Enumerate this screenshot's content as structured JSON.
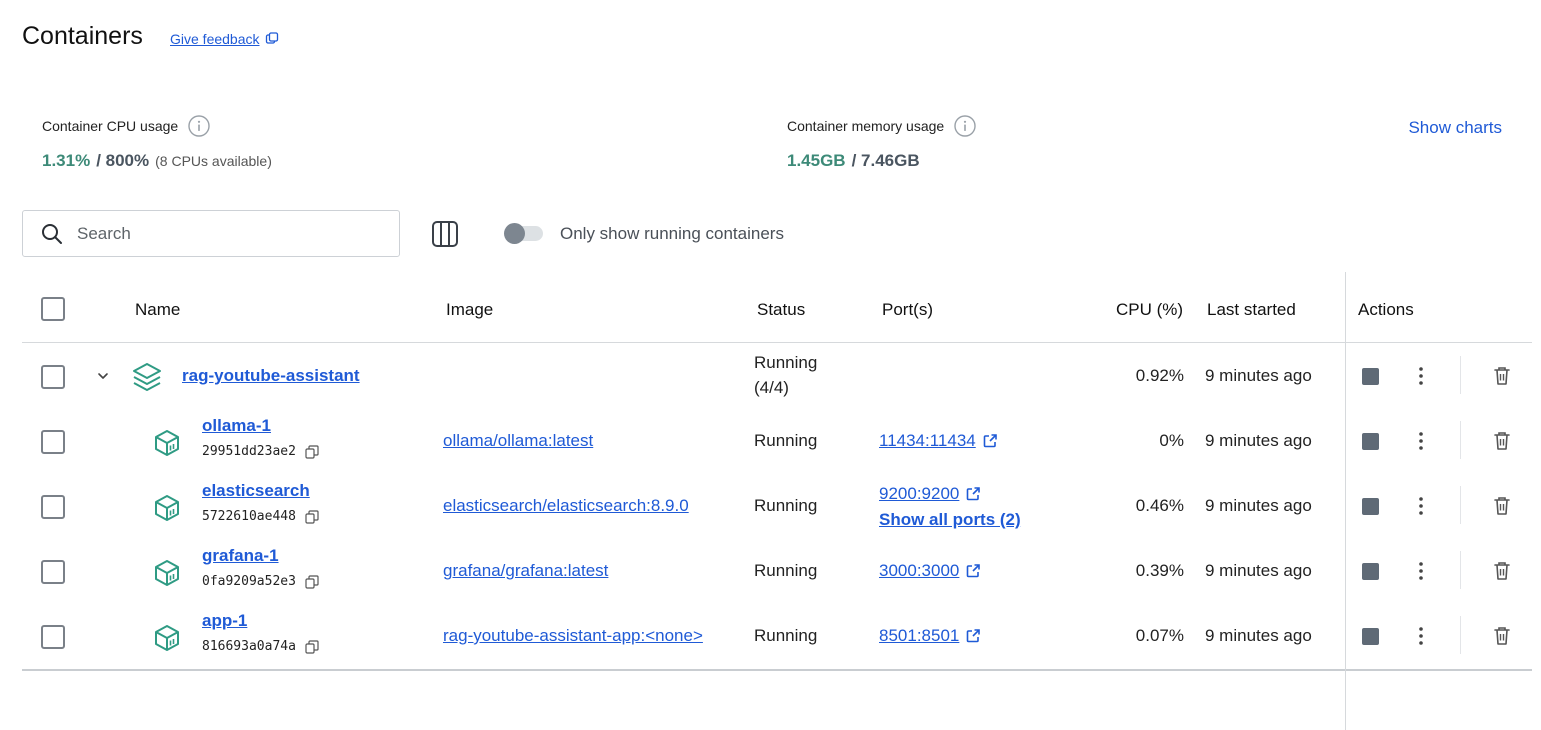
{
  "header": {
    "title": "Containers",
    "feedback_label": "Give feedback"
  },
  "stats": {
    "cpu": {
      "label": "Container CPU usage",
      "used": "1.31%",
      "total": "/ 800%",
      "note": "(8 CPUs available)"
    },
    "memory": {
      "label": "Container memory usage",
      "used": "1.45GB",
      "total": "/ 7.46GB"
    },
    "show_charts_label": "Show charts"
  },
  "toolbar": {
    "search_placeholder": "Search",
    "only_running_label": "Only show running containers",
    "only_running_enabled": false
  },
  "table": {
    "columns": {
      "name": "Name",
      "image": "Image",
      "status": "Status",
      "ports": "Port(s)",
      "cpu": "CPU (%)",
      "last_started": "Last started",
      "actions": "Actions"
    },
    "group": {
      "name": "rag-youtube-assistant",
      "status_line1": "Running",
      "status_line2": "(4/4)",
      "cpu": "0.92%",
      "last_started": "9 minutes ago"
    },
    "rows": [
      {
        "name": "ollama-1",
        "id": "29951dd23ae2",
        "image": "ollama/ollama:latest",
        "status": "Running",
        "port": "11434:11434",
        "cpu": "0%",
        "last_started": "9 minutes ago"
      },
      {
        "name": "elasticsearch",
        "id": "5722610ae448",
        "image": "elasticsearch/elasticsearch:8.9.0",
        "status": "Running",
        "port": "9200:9200",
        "all_ports": "Show all ports (2)",
        "cpu": "0.46%",
        "last_started": "9 minutes ago"
      },
      {
        "name": "grafana-1",
        "id": "0fa9209a52e3",
        "image": "grafana/grafana:latest",
        "status": "Running",
        "port": "3000:3000",
        "cpu": "0.39%",
        "last_started": "9 minutes ago"
      },
      {
        "name": "app-1",
        "id": "816693a0a74a",
        "image": "rag-youtube-assistant-app:<none>",
        "status": "Running",
        "port": "8501:8501",
        "cpu": "0.07%",
        "last_started": "9 minutes ago"
      }
    ]
  },
  "colors": {
    "link": "#1f5ad6",
    "accent_green": "#3d8a78",
    "icon_teal": "#2f9b84"
  },
  "icons": {
    "feedback": "external-window-icon",
    "info": "info-icon",
    "search": "search-icon",
    "columns": "columns-icon",
    "chevron": "chevron-down-icon",
    "stack": "stack-icon",
    "container": "container-cube-icon",
    "copy": "copy-icon",
    "external": "external-link-icon",
    "stop": "stop-icon",
    "more": "kebab-menu-icon",
    "delete": "trash-icon"
  }
}
